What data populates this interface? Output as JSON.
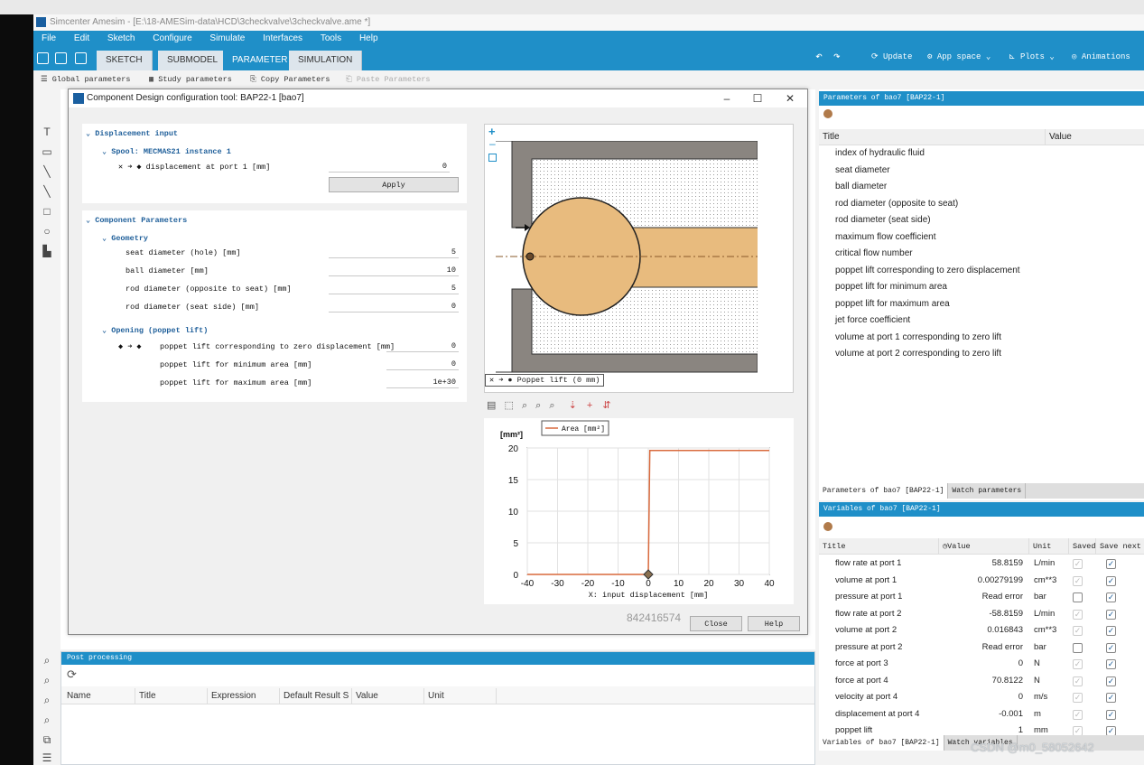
{
  "window": {
    "title": "Simcenter Amesim - [E:\\18-AMESim-data\\HCD\\3checkvalve\\3checkvalve.ame *]"
  },
  "menu": [
    "File",
    "Edit",
    "Sketch",
    "Configure",
    "Simulate",
    "Interfaces",
    "Tools",
    "Help"
  ],
  "tabs": [
    "SKETCH",
    "SUBMODEL",
    "PARAMETER",
    "SIMULATION"
  ],
  "active_tab": "PARAMETER",
  "ribbon_right": {
    "update": "Update",
    "app_space": "App space",
    "plots": "Plots",
    "animations": "Animations"
  },
  "subbar": {
    "global": "Global parameters",
    "study": "Study parameters",
    "copy": "Copy Parameters",
    "paste": "Paste Parameters"
  },
  "dialog": {
    "title": "Component Design configuration tool: BAP22-1 [bao7]",
    "displacement_input": {
      "header": "Displacement input",
      "spool": "Spool: MECMAS21 instance 1",
      "label": "displacement at port 1 [mm]",
      "value": "0",
      "apply": "Apply"
    },
    "component_parameters": {
      "header": "Component Parameters",
      "geometry_header": "Geometry",
      "geometry": [
        {
          "label": "seat diameter (hole) [mm]",
          "value": "5"
        },
        {
          "label": "ball diameter [mm]",
          "value": "10"
        },
        {
          "label": "rod diameter (opposite to seat) [mm]",
          "value": "5"
        },
        {
          "label": "rod diameter (seat side) [mm]",
          "value": "0"
        }
      ],
      "opening_header": "Opening (poppet lift)",
      "opening": [
        {
          "label": "poppet lift corresponding to zero displacement [mm]",
          "value": "0"
        },
        {
          "label": "poppet lift for minimum area [mm]",
          "value": "0"
        },
        {
          "label": "poppet lift for maximum area [mm]",
          "value": "1e+30"
        }
      ]
    },
    "sketch_caption": "Poppet lift (0 mm)",
    "plot": {
      "unit": "[mm²]",
      "legend": "Area [mm²]",
      "xlabel": "X: input displacement [mm]"
    },
    "id_text": "842416574",
    "close": "Close",
    "help": "Help"
  },
  "chart_data": {
    "type": "line",
    "title": "",
    "xlabel": "X: input displacement [mm]",
    "ylabel": "[mm²]",
    "xlim": [
      -40,
      40
    ],
    "ylim": [
      0,
      20
    ],
    "xticks": [
      -40,
      -30,
      -20,
      -10,
      0,
      10,
      20,
      30,
      40
    ],
    "yticks": [
      0,
      5,
      10,
      15,
      20
    ],
    "series": [
      {
        "name": "Area [mm²]",
        "color": "#d9693c",
        "x": [
          -40,
          0,
          0.5,
          1,
          40
        ],
        "y": [
          0,
          0,
          19.6,
          19.6,
          19.6
        ]
      }
    ],
    "marker": {
      "x": 0,
      "y": 0
    }
  },
  "params_panel": {
    "header": "Parameters of bao7 [BAP22-1]",
    "col_title": "Title",
    "col_value": "Value",
    "items": [
      "index of hydraulic fluid",
      "seat diameter",
      "ball diameter",
      "rod diameter (opposite to seat)",
      "rod diameter (seat side)",
      "maximum flow coefficient",
      "critical flow number",
      "poppet lift corresponding to zero displacement",
      "poppet lift for minimum area",
      "poppet lift for maximum area",
      "jet force coefficient",
      "volume at port 1 corresponding to zero lift",
      "volume at port 2 corresponding to zero lift"
    ],
    "tab1": "Parameters of bao7 [BAP22-1]",
    "tab2": "Watch parameters"
  },
  "vars_panel": {
    "header": "Variables of bao7 [BAP22-1]",
    "cols": [
      "Title",
      "Value",
      "Unit",
      "Saved",
      "Save next"
    ],
    "rows": [
      {
        "title": "flow rate at port 1",
        "value": "58.8159",
        "unit": "L/min",
        "saved": "dim",
        "next": true
      },
      {
        "title": "volume at port 1",
        "value": "0.00279199",
        "unit": "cm**3",
        "saved": "dim",
        "next": true
      },
      {
        "title": "pressure at port 1",
        "value": "Read error",
        "unit": "bar",
        "saved": "empty",
        "next": true
      },
      {
        "title": "flow rate at port 2",
        "value": "-58.8159",
        "unit": "L/min",
        "saved": "dim",
        "next": true
      },
      {
        "title": "volume at port 2",
        "value": "0.016843",
        "unit": "cm**3",
        "saved": "dim",
        "next": true
      },
      {
        "title": "pressure at port 2",
        "value": "Read error",
        "unit": "bar",
        "saved": "empty",
        "next": true
      },
      {
        "title": "force at port 3",
        "value": "0",
        "unit": "N",
        "saved": "dim",
        "next": true
      },
      {
        "title": "force at port 4",
        "value": "70.8122",
        "unit": "N",
        "saved": "dim",
        "next": true
      },
      {
        "title": "velocity at port 4",
        "value": "0",
        "unit": "m/s",
        "saved": "dim",
        "next": true
      },
      {
        "title": "displacement at port 4",
        "value": "-0.001",
        "unit": "m",
        "saved": "dim",
        "next": true
      },
      {
        "title": "poppet lift",
        "value": "1",
        "unit": "mm",
        "saved": "dim",
        "next": true
      }
    ],
    "tab1": "Variables of bao7 [BAP22-1]",
    "tab2": "Watch variables"
  },
  "post_processing": {
    "header": "Post processing",
    "cols": [
      "Name",
      "Title",
      "Expression",
      "Default Result S",
      "Value",
      "Unit"
    ]
  },
  "watermark": "CSDN @m0_58052642",
  "colors": {
    "accent": "#1f8fc8",
    "ball": "#e8bb7e",
    "body": "#8a8580"
  }
}
